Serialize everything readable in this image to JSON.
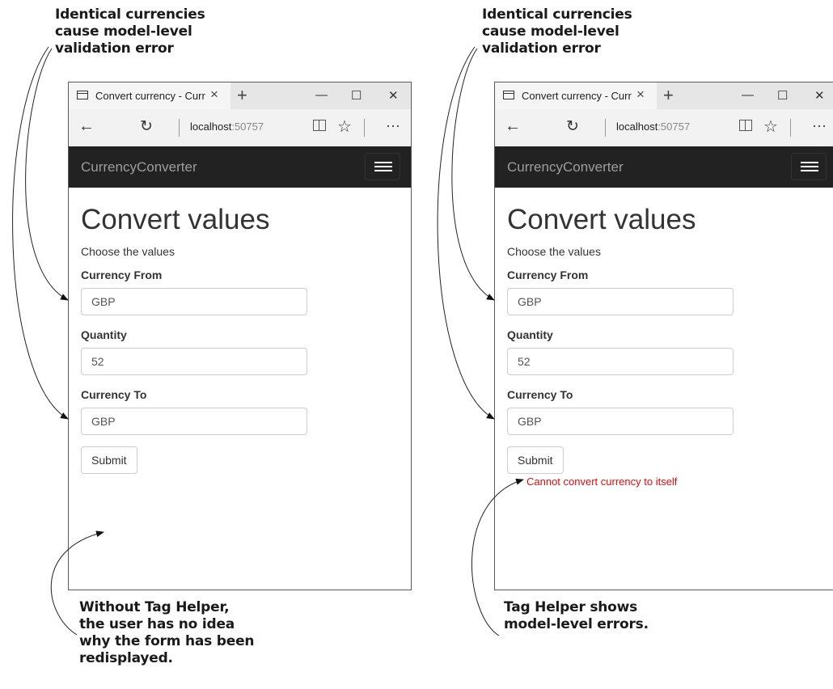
{
  "callouts": {
    "left_top": "Identical currencies\ncause model-level\nvalidation error",
    "right_top": "Identical currencies\ncause model-level\nvalidation error",
    "left_bottom": "Without Tag Helper,\nthe user has no idea\nwhy the form has been\nredisplayed.",
    "right_bottom": "Tag Helper shows\nmodel-level errors."
  },
  "browser": {
    "tab_title": "Convert currency - Curr",
    "tab_close": "×",
    "new_tab": "+",
    "win_min": "—",
    "win_max": "☐",
    "win_close": "✕",
    "back": "←",
    "refresh": "↻",
    "url_host": "localhost",
    "url_port": ":50757",
    "favorite": "☆",
    "more": "···"
  },
  "app": {
    "brand": "CurrencyConverter",
    "heading": "Convert values",
    "subheading": "Choose the values",
    "currency_from_label": "Currency From",
    "currency_from_value": "GBP",
    "quantity_label": "Quantity",
    "quantity_value": "52",
    "currency_to_label": "Currency To",
    "currency_to_value": "GBP",
    "submit_label": "Submit",
    "error_message": "Cannot convert currency to itself"
  },
  "icons": [
    "page-icon",
    "close-icon",
    "plus-icon",
    "minimize-icon",
    "maximize-icon",
    "back-arrow-icon",
    "refresh-icon",
    "reading-view-icon",
    "star-icon",
    "more-icon",
    "hamburger-icon"
  ],
  "colors": {
    "navbar": "#222222",
    "error": "#e10b0b",
    "brand": "#9d9d9d"
  }
}
